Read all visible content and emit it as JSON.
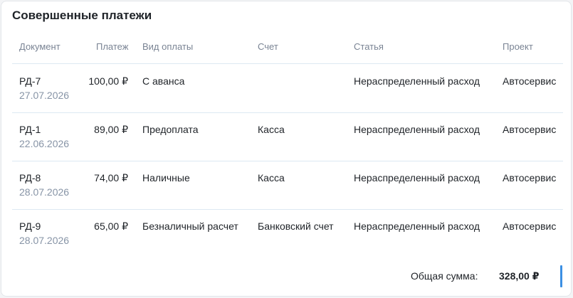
{
  "title": "Совершенные платежи",
  "columns": {
    "document": "Документ",
    "payment": "Платеж",
    "payment_type": "Вид оплаты",
    "account": "Счет",
    "article": "Статья",
    "project": "Проект"
  },
  "rows": [
    {
      "doc": "РД-7",
      "date": "27.07.2026",
      "amount": "100,00 ₽",
      "type": "С аванса",
      "account": "",
      "article": "Нераспределенный расход",
      "project": "Автосервис"
    },
    {
      "doc": "РД-1",
      "date": "22.06.2026",
      "amount": "89,00 ₽",
      "type": "Предоплата",
      "account": "Касса",
      "article": "Нераспределенный расход",
      "project": "Автосервис"
    },
    {
      "doc": "РД-8",
      "date": "28.07.2026",
      "amount": "74,00 ₽",
      "type": "Наличные",
      "account": "Касса",
      "article": "Нераспределенный расход",
      "project": "Автосервис"
    },
    {
      "doc": "РД-9",
      "date": "28.07.2026",
      "amount": "65,00 ₽",
      "type": "Безналичный расчет",
      "account": "Банковский счет",
      "article": "Нераспределенный расход",
      "project": "Автосервис"
    }
  ],
  "total": {
    "label": "Общая сумма:",
    "value": "328,00 ₽"
  },
  "colors": {
    "accent": "#3b8fe3",
    "divider": "#dde9f2",
    "muted": "#8794a6"
  }
}
